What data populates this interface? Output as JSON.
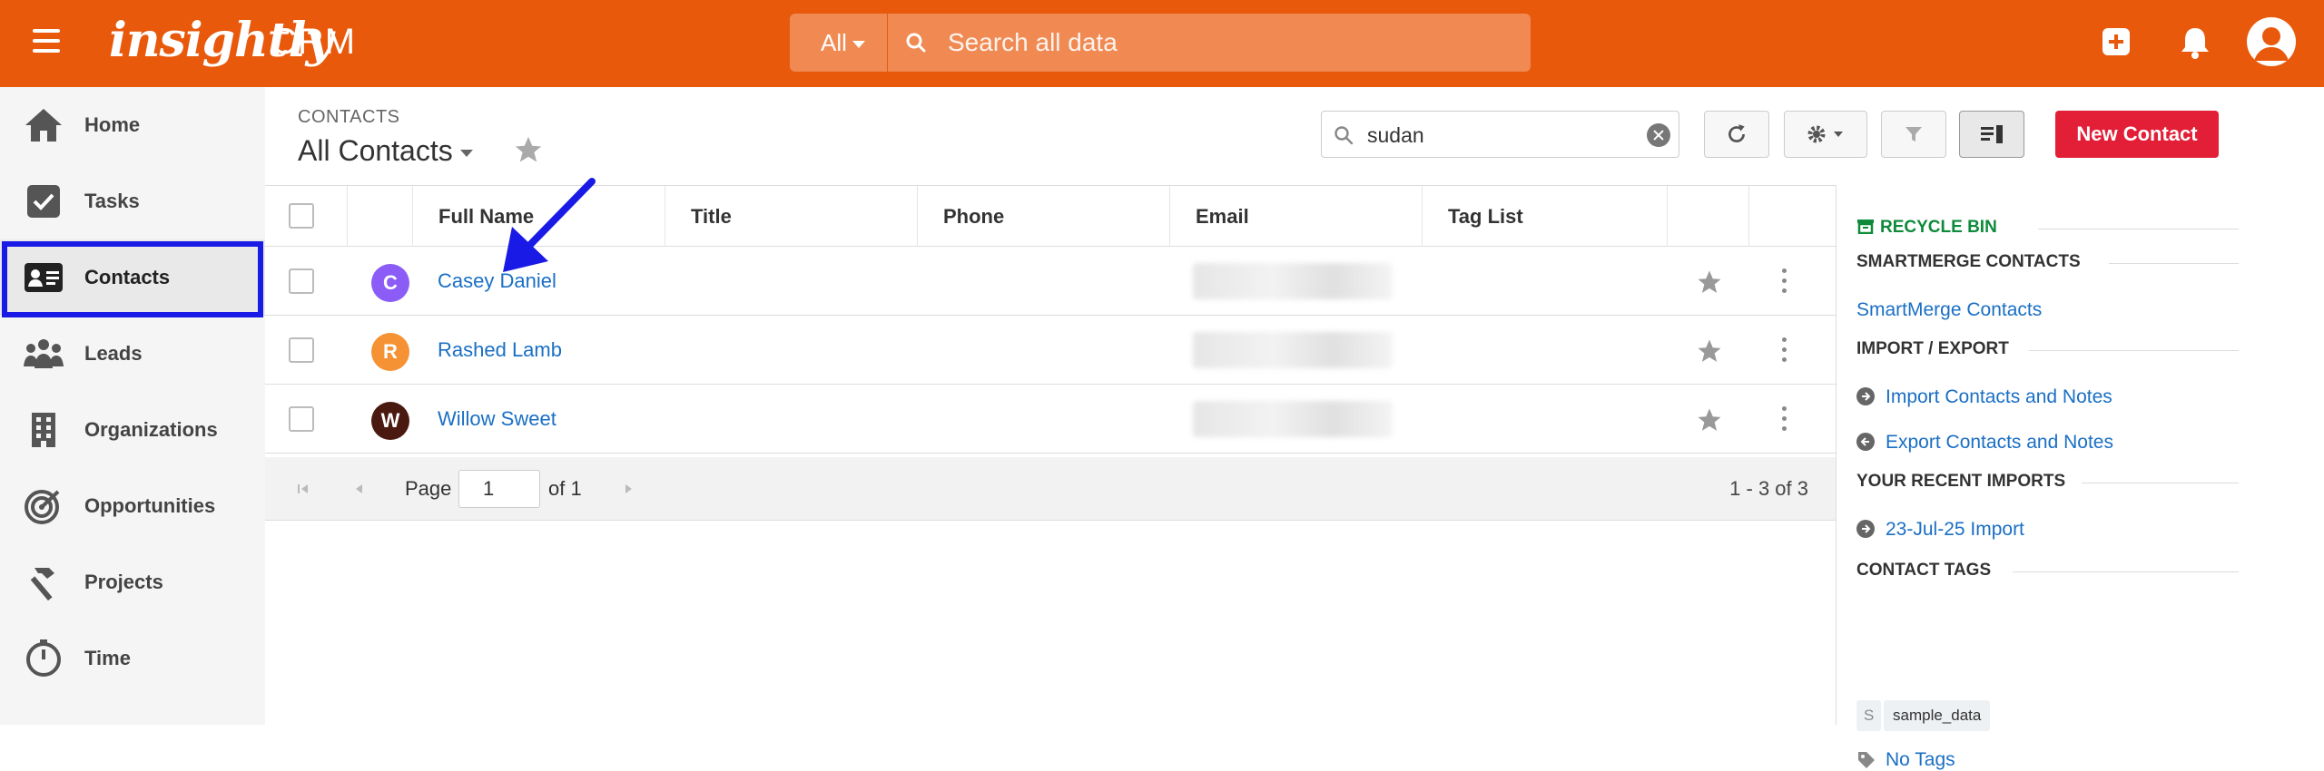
{
  "app": {
    "brand": "insightly",
    "product": "CRM",
    "accent": "#e8590c"
  },
  "topbar": {
    "search_scope": "All",
    "search_placeholder": "Search all data",
    "icons": [
      "menu-icon",
      "add-icon",
      "bell-icon",
      "user-avatar-icon"
    ]
  },
  "sidebar": {
    "items": [
      {
        "label": "Home",
        "icon": "home-icon"
      },
      {
        "label": "Tasks",
        "icon": "tasks-icon"
      },
      {
        "label": "Contacts",
        "icon": "contact-card-icon",
        "active": true
      },
      {
        "label": "Leads",
        "icon": "leads-icon"
      },
      {
        "label": "Organizations",
        "icon": "building-icon"
      },
      {
        "label": "Opportunities",
        "icon": "target-icon"
      },
      {
        "label": "Projects",
        "icon": "hammer-icon"
      },
      {
        "label": "Time",
        "icon": "timer-icon"
      }
    ]
  },
  "header": {
    "breadcrumb": "CONTACTS",
    "view_title": "All Contacts",
    "list_search_value": "sudan",
    "new_contact_label": "New Contact"
  },
  "table": {
    "columns": [
      "Full Name",
      "Title",
      "Phone",
      "Email",
      "Tag List"
    ],
    "rows": [
      {
        "initial": "C",
        "name": "Casey Daniel",
        "avatar_color": "#8b5cf6"
      },
      {
        "initial": "R",
        "name": "Rashed Lamb",
        "avatar_color": "#f59234"
      },
      {
        "initial": "W",
        "name": "Willow Sweet",
        "avatar_color": "#4a1a10"
      }
    ]
  },
  "pager": {
    "page_label": "Page",
    "page_value": "1",
    "of_label": "of 1",
    "count": "1 - 3 of 3"
  },
  "right_panel": {
    "recycle_bin": "RECYCLE BIN",
    "smartmerge_head": "SMARTMERGE CONTACTS",
    "smartmerge_link": "SmartMerge Contacts",
    "import_export_head": "IMPORT / EXPORT",
    "import_link": "Import Contacts and Notes",
    "export_link": "Export Contacts and Notes",
    "recent_imports_head": "YOUR RECENT IMPORTS",
    "recent_import_link": "23-Jul-25 Import",
    "contact_tags_head": "CONTACT TAGS",
    "tag_letter": "S",
    "tag_name": "sample_data",
    "no_tags_link": "No Tags"
  }
}
